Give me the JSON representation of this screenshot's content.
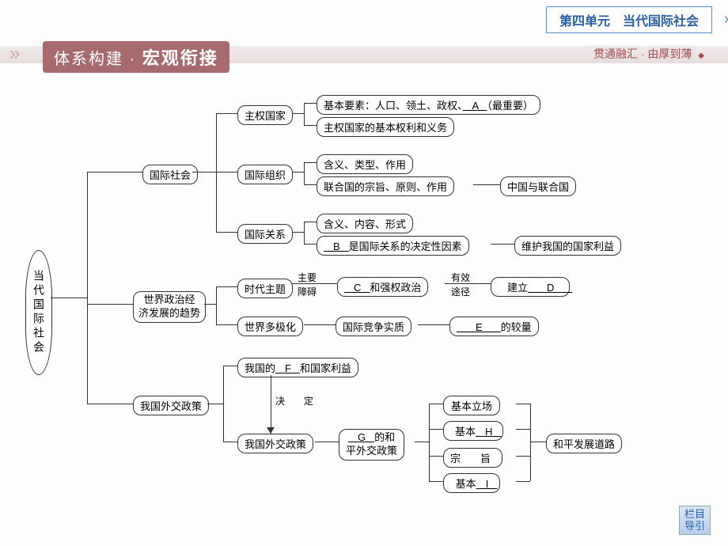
{
  "header": {
    "unit_label": "第四单元　当代国际社会"
  },
  "title_strip": {
    "left_small": "体系构建 · ",
    "left_big": "宏观衔接",
    "right_text": "贯通融汇 · 由厚到薄"
  },
  "nav": {
    "label": "栏目\n导引"
  },
  "diagram": {
    "root": "当代国际社会",
    "b1": "国际社会",
    "b2": "世界政治经\n济发展的趋势",
    "b3": "我国外交政策",
    "b1_1": "主权国家",
    "b1_2": "国际组织",
    "b1_3": "国际关系",
    "b1_1_a": "基本要素：人口、领土、政权、",
    "b1_1_a_blank": "　A　",
    "b1_1_a_tail": "（最重要）",
    "b1_1_b": "主权国家的基本权利和义务",
    "b1_2_a": "含义、类型、作用",
    "b1_2_b": "联合国的宗旨、原则、作用",
    "b1_2_c": "中国与联合国",
    "b1_3_a": "含义、内容、形式",
    "b1_3_b_blank": "　B　",
    "b1_3_b_tail": "是国际关系的决定性因素",
    "b1_3_c": "维护我国的国家利益",
    "b2_1": "时代主题",
    "b2_2": "世界多极化",
    "b2_lbl1_top": "主要",
    "b2_lbl1_bot": "障碍",
    "b2_c_blank": "　C　",
    "b2_c_tail": "和强权政治",
    "b2_lbl2_top": "有效",
    "b2_lbl2_bot": "途径",
    "b2_d_pre": "建立",
    "b2_d_blank": "　　D　　",
    "b2_e": "国际竞争实质",
    "b2_e2_blank": "　　E　　",
    "b2_e2_tail": "的较量",
    "b3_1_pre": "我国的",
    "b3_1_blank": "　F　",
    "b3_1_tail": "和国家利益",
    "b3_mid": "决　定",
    "b3_2": "我国外交政策",
    "b3_g_blank": "　G　",
    "b3_g_line1_tail": "的和",
    "b3_g_line2": "平外交政策",
    "b3_list_1": "基本立场",
    "b3_list_2_pre": "基本",
    "b3_list_2_blank": "　H　",
    "b3_list_3": "宗　旨",
    "b3_list_4_pre": "基本",
    "b3_list_4_blank": "　I　",
    "b3_end": "和平发展道路"
  }
}
